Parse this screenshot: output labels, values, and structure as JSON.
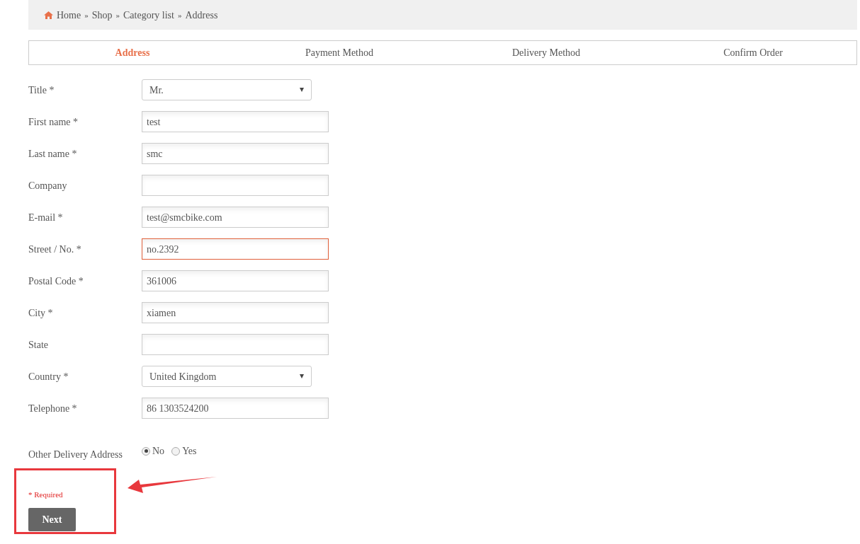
{
  "breadcrumb": [
    {
      "label": "Home"
    },
    {
      "separator": "»",
      "label": "Shop"
    },
    {
      "separator": "»",
      "label": "Category list"
    },
    {
      "separator": "»",
      "label": "Address"
    }
  ],
  "steps": [
    {
      "label": "Address",
      "selected": true
    },
    {
      "label": "Payment Method",
      "selected": false
    },
    {
      "label": "Delivery Method",
      "selected": false
    },
    {
      "label": "Confirm Order",
      "selected": false
    }
  ],
  "fields": [
    {
      "label": "Title *",
      "kind": "select",
      "value": "Mr.",
      "focused": false
    },
    {
      "label": "First name *",
      "kind": "text",
      "value": "test",
      "focused": false
    },
    {
      "label": "Last name *",
      "kind": "text",
      "value": "smc",
      "focused": false
    },
    {
      "label": "Company",
      "kind": "text",
      "focused": false
    },
    {
      "label": "E-mail *",
      "kind": "text",
      "value": "test@smcbike.com",
      "focused": false
    },
    {
      "label": "Street / No. *",
      "kind": "text",
      "value": "no.2392",
      "focused": true
    },
    {
      "label": "Postal Code *",
      "kind": "text",
      "value": "361006",
      "focused": false
    },
    {
      "label": "City *",
      "kind": "text",
      "value": "xiamen",
      "focused": false
    },
    {
      "label": "State",
      "kind": "text",
      "focused": false
    },
    {
      "label": "Country *",
      "kind": "select",
      "value": "United Kingdom",
      "focused": false
    },
    {
      "label": "Telephone *",
      "kind": "text",
      "value": "86 1303524200",
      "focused": false
    }
  ],
  "other_delivery": {
    "label": "Other Delivery Address",
    "options": [
      {
        "label": "No",
        "selected": true
      },
      {
        "label": "Yes",
        "selected": false
      }
    ]
  },
  "required_note": "* Required",
  "next_button": "Next"
}
